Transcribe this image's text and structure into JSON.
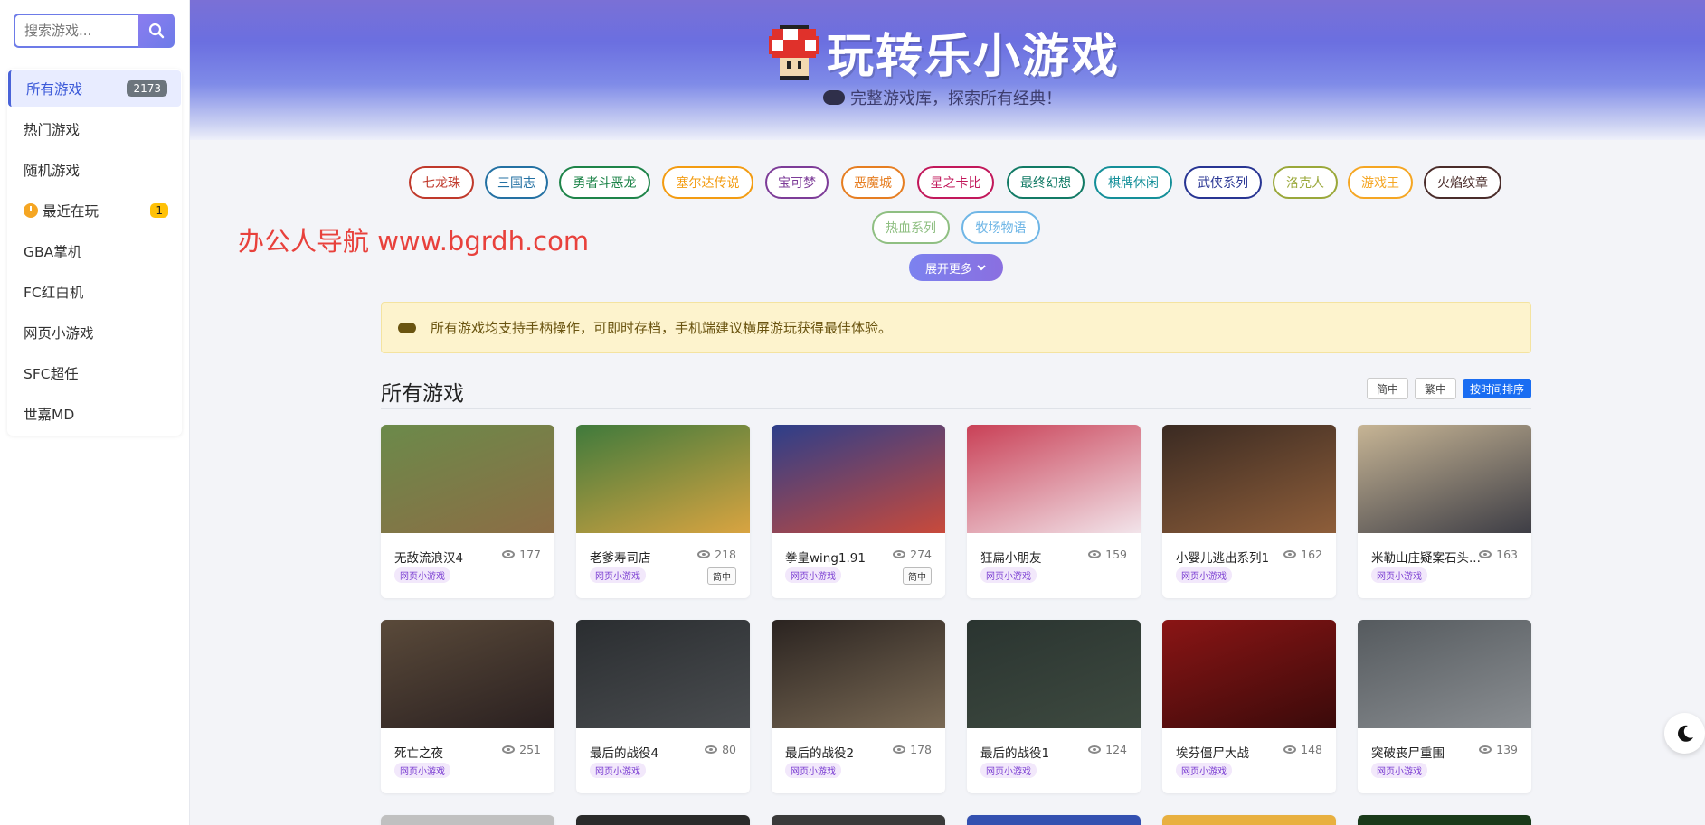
{
  "sidebar": {
    "search_placeholder": "搜索游戏...",
    "items": [
      {
        "label": "所有游戏",
        "count": "2173"
      },
      {
        "label": "热门游戏"
      },
      {
        "label": "随机游戏"
      },
      {
        "label": "最近在玩",
        "count": "1"
      },
      {
        "label": "GBA掌机"
      },
      {
        "label": "FC红白机"
      },
      {
        "label": "网页小游戏"
      },
      {
        "label": "SFC超任"
      },
      {
        "label": "世嘉MD"
      }
    ]
  },
  "header": {
    "title": "玩转乐小游戏",
    "subtitle": "完整游戏库，探索所有经典！"
  },
  "tags": [
    {
      "label": "七龙珠",
      "color": "#c0392b"
    },
    {
      "label": "三国志",
      "color": "#2471a3"
    },
    {
      "label": "勇者斗恶龙",
      "color": "#1e8449"
    },
    {
      "label": "塞尔达传说",
      "color": "#f39c12"
    },
    {
      "label": "宝可梦",
      "color": "#7d3c98"
    },
    {
      "label": "恶魔城",
      "color": "#e67e22"
    },
    {
      "label": "星之卡比",
      "color": "#c2185b"
    },
    {
      "label": "最终幻想",
      "color": "#117a65"
    },
    {
      "label": "棋牌休闲",
      "color": "#148f99"
    },
    {
      "label": "武侠系列",
      "color": "#283593"
    },
    {
      "label": "洛克人",
      "color": "#9aa83a"
    },
    {
      "label": "游戏王",
      "color": "#f5a623"
    },
    {
      "label": "火焰纹章",
      "color": "#4a2c2a"
    },
    {
      "label": "热血系列",
      "color": "#8fbf82"
    },
    {
      "label": "牧场物语",
      "color": "#6fb6e6"
    }
  ],
  "expand_label": "展开更多",
  "watermark": "办公人导航 www.bgrdh.com",
  "notice": "所有游戏均支持手柄操作，可即时存档，手机端建议横屏游玩获得最佳体验。",
  "section": {
    "title": "所有游戏",
    "lang_simplified": "简中",
    "lang_traditional": "繁中",
    "sort_label": "按时间排序"
  },
  "games": [
    {
      "name": "无敌流浪汉4",
      "views": "177",
      "category": "网页小游戏",
      "lang": "",
      "colors": [
        "#6b8a4a",
        "#8c6d45"
      ]
    },
    {
      "name": "老爹寿司店",
      "views": "218",
      "category": "网页小游戏",
      "lang": "简中",
      "colors": [
        "#3f7a3c",
        "#d9a441"
      ]
    },
    {
      "name": "拳皇wing1.91",
      "views": "274",
      "category": "网页小游戏",
      "lang": "简中",
      "colors": [
        "#2c3e8a",
        "#c94a3b"
      ]
    },
    {
      "name": "狂扁小朋友",
      "views": "159",
      "category": "网页小游戏",
      "lang": "",
      "colors": [
        "#c94056",
        "#f2e4ea"
      ]
    },
    {
      "name": "小婴儿逃出系列1",
      "views": "162",
      "category": "网页小游戏",
      "lang": "",
      "colors": [
        "#3a2a22",
        "#8e5e3a"
      ]
    },
    {
      "name": "米勒山庄疑案石头...",
      "views": "163",
      "category": "网页小游戏",
      "lang": "",
      "colors": [
        "#c7b595",
        "#3d3d45"
      ]
    },
    {
      "name": "死亡之夜",
      "views": "251",
      "category": "网页小游戏",
      "lang": "",
      "colors": [
        "#5a4a3a",
        "#2a2020"
      ]
    },
    {
      "name": "最后的战役4",
      "views": "80",
      "category": "网页小游戏",
      "lang": "",
      "colors": [
        "#2a2d30",
        "#4a4d50"
      ]
    },
    {
      "name": "最后的战役2",
      "views": "178",
      "category": "网页小游戏",
      "lang": "",
      "colors": [
        "#2a2320",
        "#7a6a55"
      ]
    },
    {
      "name": "最后的战役1",
      "views": "124",
      "category": "网页小游戏",
      "lang": "",
      "colors": [
        "#2a3430",
        "#3e4a40"
      ]
    },
    {
      "name": "埃芬僵尸大战",
      "views": "148",
      "category": "网页小游戏",
      "lang": "",
      "colors": [
        "#8a1515",
        "#3a0a0a"
      ]
    },
    {
      "name": "突破丧尸重围",
      "views": "139",
      "category": "网页小游戏",
      "lang": "",
      "colors": [
        "#555a5e",
        "#8a8e92"
      ]
    }
  ],
  "partial_row_colors": [
    "#c0c0c0",
    "#2a2a2a",
    "#3a3a3a",
    "#3350b0",
    "#e8b040",
    "#1a3a1a"
  ]
}
